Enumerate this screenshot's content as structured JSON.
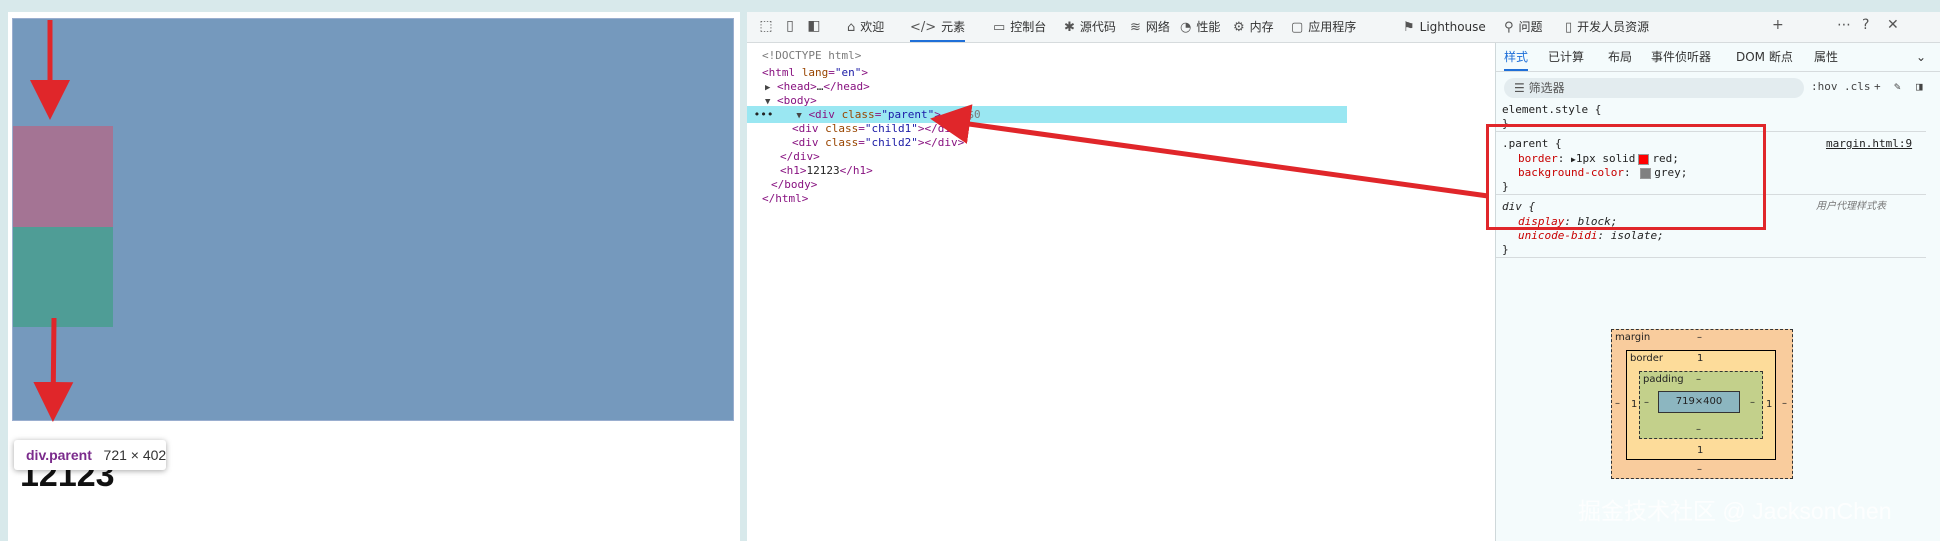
{
  "viewport": {
    "tooltip_selector": "div.parent",
    "tooltip_size": "721 × 402",
    "h1_text": "12123"
  },
  "devtools_tabs": [
    {
      "icon": "⌂",
      "label": "欢迎"
    },
    {
      "icon": "</>",
      "label": "元素"
    },
    {
      "icon": "▭",
      "label": "控制台"
    },
    {
      "icon": "✱",
      "label": "源代码"
    },
    {
      "icon": "≋",
      "label": "网络"
    },
    {
      "icon": "◔",
      "label": "性能"
    },
    {
      "icon": "⚙",
      "label": "内存"
    },
    {
      "icon": "▢",
      "label": "应用程序"
    },
    {
      "icon": "⚑",
      "label": "Lighthouse"
    },
    {
      "icon": "⚲",
      "label": "问题"
    },
    {
      "icon": "▯",
      "label": "开发人员资源"
    }
  ],
  "dom": {
    "doctype": "<!DOCTYPE html>",
    "html_open": "<html",
    "lang_attr": "lang",
    "lang_val": "\"en\"",
    "head": "<head>",
    "head_close": "</head>",
    "ellipsis": "…",
    "body_open": "<body>",
    "div_parent": "<div",
    "class_attr": "class",
    "parent_val": "\"parent\"",
    "child1_val": "\"child1\"",
    "child2_val": "\"child2\"",
    "div_close": "</div>",
    "h1_open": "<h1>",
    "h1_text": "12123",
    "h1_close": "</h1>",
    "body_close": "</body>",
    "html_close": "</html>",
    "eq_marker": "== $0"
  },
  "side_tabs": [
    "样式",
    "已计算",
    "布局",
    "事件侦听器",
    "DOM 断点",
    "属性"
  ],
  "filter_placeholder": "筛选器",
  "hov_label": ":hov",
  "cls_label": ".cls",
  "styles": {
    "element_style": "element.style {",
    "close_brace": "}",
    "parent_selector": ".parent {",
    "parent_source": "margin.html:9",
    "border_prop": "border",
    "border_val": "1px solid",
    "border_color_name": "red;",
    "bg_prop": "background-color",
    "bg_color_name": "grey;",
    "div_selector": "div {",
    "ua_source": "用户代理样式表",
    "display_prop": "display",
    "display_val": "block;",
    "unicode_prop": "unicode-bidi",
    "unicode_val": "isolate;"
  },
  "box_model": {
    "margin_label": "margin",
    "border_label": "border",
    "padding_label": "padding",
    "content_size": "719×400",
    "margin_val": "–",
    "border_val": "1",
    "padding_val": "–"
  },
  "watermark": "掘金技术社区 @ JacksonChen",
  "colors": {
    "parent_bg": "#7599bd",
    "child1_bg": "#a47494",
    "child2_bg": "#4f9d96",
    "selected_row": "#9ae7f2",
    "annotation_red": "#e0262a",
    "swatch_red": "#ff0000",
    "swatch_grey": "#808080"
  }
}
